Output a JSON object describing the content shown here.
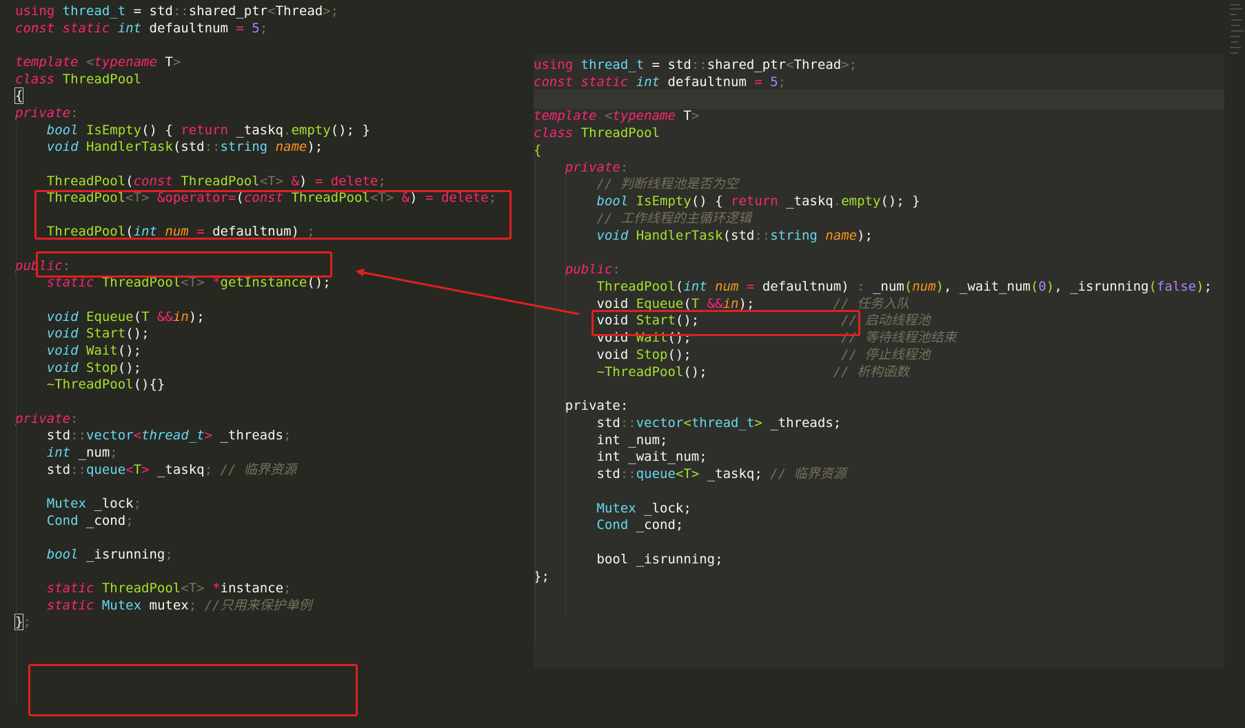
{
  "left_code": [
    [
      {
        "t": "using",
        "c": "kw"
      },
      {
        "t": " "
      },
      {
        "t": "thread_t",
        "c": "cls"
      },
      {
        "t": " = "
      },
      {
        "t": "std",
        "c": "txt"
      },
      {
        "t": "::",
        "c": "ph"
      },
      {
        "t": "shared_ptr",
        "c": "txt"
      },
      {
        "t": "<",
        "c": "ph"
      },
      {
        "t": "Thread",
        "c": "txt"
      },
      {
        "t": ">;",
        "c": "ph"
      }
    ],
    [
      {
        "t": "const",
        "c": "special"
      },
      {
        "t": " "
      },
      {
        "t": "static",
        "c": "special"
      },
      {
        "t": " "
      },
      {
        "t": "int",
        "c": "type"
      },
      {
        "t": " defaultnum "
      },
      {
        "t": "=",
        "c": "kw"
      },
      {
        "t": " "
      },
      {
        "t": "5",
        "c": "num"
      },
      {
        "t": ";",
        "c": "ph"
      }
    ],
    [],
    [
      {
        "t": "template",
        "c": "special"
      },
      {
        "t": " "
      },
      {
        "t": "<",
        "c": "ph"
      },
      {
        "t": "typename",
        "c": "special"
      },
      {
        "t": " T"
      },
      {
        "t": ">",
        "c": "ph"
      }
    ],
    [
      {
        "t": "class",
        "c": "special"
      },
      {
        "t": " "
      },
      {
        "t": "ThreadPool",
        "c": "fn"
      }
    ],
    [
      {
        "t": "{",
        "c": "brace"
      }
    ],
    [
      {
        "t": "private",
        "c": "special"
      },
      {
        "t": ":",
        "c": "ph"
      }
    ],
    [
      {
        "t": "    "
      },
      {
        "t": "bool",
        "c": "type"
      },
      {
        "t": " "
      },
      {
        "t": "IsEmpty",
        "c": "fn"
      },
      {
        "t": "() { "
      },
      {
        "t": "return",
        "c": "kw"
      },
      {
        "t": " _taskq"
      },
      {
        "t": ".",
        "c": "ph"
      },
      {
        "t": "empty",
        "c": "fn"
      },
      {
        "t": "(); }"
      }
    ],
    [
      {
        "t": "    "
      },
      {
        "t": "void",
        "c": "type"
      },
      {
        "t": " "
      },
      {
        "t": "HandlerTask",
        "c": "fn"
      },
      {
        "t": "(std"
      },
      {
        "t": "::",
        "c": "ph"
      },
      {
        "t": "string",
        "c": "cls"
      },
      {
        "t": " "
      },
      {
        "t": "name",
        "c": "param"
      },
      {
        "t": ");"
      }
    ],
    [],
    [
      {
        "t": "    "
      },
      {
        "t": "ThreadPool",
        "c": "fn"
      },
      {
        "t": "("
      },
      {
        "t": "const",
        "c": "special"
      },
      {
        "t": " "
      },
      {
        "t": "ThreadPool",
        "c": "fn"
      },
      {
        "t": "<",
        "c": "ph"
      },
      {
        "t": "T",
        "c": "ph"
      },
      {
        "t": ">",
        "c": "ph"
      },
      {
        "t": " "
      },
      {
        "t": "&",
        "c": "kw"
      },
      {
        "t": ") "
      },
      {
        "t": "=",
        "c": "kw"
      },
      {
        "t": " "
      },
      {
        "t": "delete",
        "c": "kw"
      },
      {
        "t": ";",
        "c": "ph"
      }
    ],
    [
      {
        "t": "    "
      },
      {
        "t": "ThreadPool",
        "c": "fn"
      },
      {
        "t": "<",
        "c": "ph"
      },
      {
        "t": "T",
        "c": "ph"
      },
      {
        "t": ">",
        "c": "ph"
      },
      {
        "t": " "
      },
      {
        "t": "&",
        "c": "kw"
      },
      {
        "t": "operator=",
        "c": "kw"
      },
      {
        "t": "("
      },
      {
        "t": "const",
        "c": "special"
      },
      {
        "t": " "
      },
      {
        "t": "ThreadPool",
        "c": "fn"
      },
      {
        "t": "<",
        "c": "ph"
      },
      {
        "t": "T",
        "c": "ph"
      },
      {
        "t": ">",
        "c": "ph"
      },
      {
        "t": " "
      },
      {
        "t": "&",
        "c": "kw"
      },
      {
        "t": ") "
      },
      {
        "t": "=",
        "c": "kw"
      },
      {
        "t": " "
      },
      {
        "t": "delete",
        "c": "kw"
      },
      {
        "t": ";",
        "c": "ph"
      }
    ],
    [],
    [
      {
        "t": "    "
      },
      {
        "t": "ThreadPool",
        "c": "fn"
      },
      {
        "t": "("
      },
      {
        "t": "int",
        "c": "type"
      },
      {
        "t": " "
      },
      {
        "t": "num",
        "c": "param"
      },
      {
        "t": " "
      },
      {
        "t": "=",
        "c": "kw"
      },
      {
        "t": " defaultnum) "
      },
      {
        "t": ";",
        "c": "ph"
      }
    ],
    [],
    [
      {
        "t": "public",
        "c": "special"
      },
      {
        "t": ":",
        "c": "ph"
      }
    ],
    [
      {
        "t": "    "
      },
      {
        "t": "static",
        "c": "special"
      },
      {
        "t": " "
      },
      {
        "t": "ThreadPool",
        "c": "fn"
      },
      {
        "t": "<",
        "c": "ph"
      },
      {
        "t": "T",
        "c": "ph"
      },
      {
        "t": ">",
        "c": "ph"
      },
      {
        "t": " "
      },
      {
        "t": "*",
        "c": "kw"
      },
      {
        "t": "getInstance",
        "c": "fn"
      },
      {
        "t": "();"
      }
    ],
    [],
    [
      {
        "t": "    "
      },
      {
        "t": "void",
        "c": "type"
      },
      {
        "t": " "
      },
      {
        "t": "Equeue",
        "c": "fn"
      },
      {
        "t": "("
      },
      {
        "t": "T",
        "c": "fn"
      },
      {
        "t": " "
      },
      {
        "t": "&&",
        "c": "kw"
      },
      {
        "t": "in",
        "c": "param"
      },
      {
        "t": ");"
      }
    ],
    [
      {
        "t": "    "
      },
      {
        "t": "void",
        "c": "type"
      },
      {
        "t": " "
      },
      {
        "t": "Start",
        "c": "fn"
      },
      {
        "t": "();"
      }
    ],
    [
      {
        "t": "    "
      },
      {
        "t": "void",
        "c": "type"
      },
      {
        "t": " "
      },
      {
        "t": "Wait",
        "c": "fn"
      },
      {
        "t": "();"
      }
    ],
    [
      {
        "t": "    "
      },
      {
        "t": "void",
        "c": "type"
      },
      {
        "t": " "
      },
      {
        "t": "Stop",
        "c": "fn"
      },
      {
        "t": "();"
      }
    ],
    [
      {
        "t": "    "
      },
      {
        "t": "~ThreadPool",
        "c": "fn"
      },
      {
        "t": "(){}"
      }
    ],
    [],
    [
      {
        "t": "private",
        "c": "special"
      },
      {
        "t": ":",
        "c": "ph"
      }
    ],
    [
      {
        "t": "    std"
      },
      {
        "t": "::",
        "c": "ph"
      },
      {
        "t": "vector",
        "c": "cls"
      },
      {
        "t": "<",
        "c": "kw"
      },
      {
        "t": "thread_t",
        "c": "type"
      },
      {
        "t": ">",
        "c": "kw"
      },
      {
        "t": " _threads"
      },
      {
        "t": ";",
        "c": "ph"
      }
    ],
    [
      {
        "t": "    "
      },
      {
        "t": "int",
        "c": "type"
      },
      {
        "t": " _num"
      },
      {
        "t": ";",
        "c": "ph"
      }
    ],
    [
      {
        "t": "    std"
      },
      {
        "t": "::",
        "c": "ph"
      },
      {
        "t": "queue",
        "c": "cls"
      },
      {
        "t": "<",
        "c": "kw"
      },
      {
        "t": "T",
        "c": "fn"
      },
      {
        "t": ">",
        "c": "kw"
      },
      {
        "t": " _taskq"
      },
      {
        "t": ";",
        "c": "ph"
      },
      {
        "t": " "
      },
      {
        "t": "// 临界资源",
        "c": "comment"
      }
    ],
    [],
    [
      {
        "t": "    "
      },
      {
        "t": "Mutex",
        "c": "cls"
      },
      {
        "t": " _lock"
      },
      {
        "t": ";",
        "c": "ph"
      }
    ],
    [
      {
        "t": "    "
      },
      {
        "t": "Cond",
        "c": "cls"
      },
      {
        "t": " _cond"
      },
      {
        "t": ";",
        "c": "ph"
      }
    ],
    [],
    [
      {
        "t": "    "
      },
      {
        "t": "bool",
        "c": "type"
      },
      {
        "t": " _isrunning"
      },
      {
        "t": ";",
        "c": "ph"
      }
    ],
    [],
    [
      {
        "t": "    "
      },
      {
        "t": "static",
        "c": "special"
      },
      {
        "t": " "
      },
      {
        "t": "ThreadPool",
        "c": "fn"
      },
      {
        "t": "<",
        "c": "ph"
      },
      {
        "t": "T",
        "c": "ph"
      },
      {
        "t": ">",
        "c": "ph"
      },
      {
        "t": " "
      },
      {
        "t": "*",
        "c": "kw"
      },
      {
        "t": "instance"
      },
      {
        "t": ";",
        "c": "ph"
      }
    ],
    [
      {
        "t": "    "
      },
      {
        "t": "static",
        "c": "special"
      },
      {
        "t": " "
      },
      {
        "t": "Mutex",
        "c": "cls"
      },
      {
        "t": " mutex"
      },
      {
        "t": ";",
        "c": "ph"
      },
      {
        "t": " "
      },
      {
        "t": "//只用来保护单例",
        "c": "comment"
      }
    ],
    [
      {
        "t": "}",
        "c": "brace"
      },
      {
        "t": ";",
        "c": "ph"
      }
    ]
  ],
  "right_code": [
    [
      {
        "t": "using",
        "c": "kw"
      },
      {
        "t": " "
      },
      {
        "t": "thread_t",
        "c": "cls"
      },
      {
        "t": " = "
      },
      {
        "t": "std",
        "c": "txt"
      },
      {
        "t": "::",
        "c": "ph"
      },
      {
        "t": "shared_ptr",
        "c": "txt"
      },
      {
        "t": "<",
        "c": "ph"
      },
      {
        "t": "Thread",
        "c": "txt"
      },
      {
        "t": ">;",
        "c": "ph"
      }
    ],
    [
      {
        "t": "const",
        "c": "special"
      },
      {
        "t": " "
      },
      {
        "t": "static",
        "c": "special"
      },
      {
        "t": " "
      },
      {
        "t": "int",
        "c": "type"
      },
      {
        "t": " defaultnum "
      },
      {
        "t": "=",
        "c": "kw"
      },
      {
        "t": " "
      },
      {
        "t": "5",
        "c": "num"
      },
      {
        "t": ";",
        "c": "ph"
      }
    ],
    [],
    [
      {
        "t": "template",
        "c": "special"
      },
      {
        "t": " "
      },
      {
        "t": "<",
        "c": "ph"
      },
      {
        "t": "typename",
        "c": "special"
      },
      {
        "t": " T"
      },
      {
        "t": ">",
        "c": "ph"
      }
    ],
    [
      {
        "t": "class",
        "c": "special"
      },
      {
        "t": " "
      },
      {
        "t": "ThreadPool",
        "c": "fn"
      }
    ],
    [
      {
        "t": "{",
        "c": "fn"
      }
    ],
    [
      {
        "t": "    "
      },
      {
        "t": "private",
        "c": "special"
      },
      {
        "t": ":",
        "c": "ph"
      }
    ],
    [
      {
        "t": "        "
      },
      {
        "t": "// 判断线程池是否为空",
        "c": "comment"
      }
    ],
    [
      {
        "t": "        "
      },
      {
        "t": "bool",
        "c": "type"
      },
      {
        "t": " "
      },
      {
        "t": "IsEmpty",
        "c": "fn"
      },
      {
        "t": "() { "
      },
      {
        "t": "return",
        "c": "kw"
      },
      {
        "t": " _taskq"
      },
      {
        "t": ".",
        "c": "ph"
      },
      {
        "t": "empty",
        "c": "fn"
      },
      {
        "t": "(); }"
      }
    ],
    [
      {
        "t": "        "
      },
      {
        "t": "// 工作线程的主循环逻辑",
        "c": "comment"
      }
    ],
    [
      {
        "t": "        "
      },
      {
        "t": "void",
        "c": "type"
      },
      {
        "t": " "
      },
      {
        "t": "HandlerTask",
        "c": "fn"
      },
      {
        "t": "(std"
      },
      {
        "t": "::",
        "c": "ph"
      },
      {
        "t": "string",
        "c": "cls"
      },
      {
        "t": " "
      },
      {
        "t": "name",
        "c": "param"
      },
      {
        "t": ");"
      }
    ],
    [],
    [
      {
        "t": "    "
      },
      {
        "t": "public",
        "c": "special"
      },
      {
        "t": ":",
        "c": "ph"
      }
    ],
    [
      {
        "t": "        "
      },
      {
        "t": "ThreadPool",
        "c": "fn"
      },
      {
        "t": "("
      },
      {
        "t": "int",
        "c": "type"
      },
      {
        "t": " "
      },
      {
        "t": "num",
        "c": "param"
      },
      {
        "t": " "
      },
      {
        "t": "=",
        "c": "kw"
      },
      {
        "t": " defaultnum)"
      },
      {
        "t": " : ",
        "c": "ph"
      },
      {
        "t": "_num"
      },
      {
        "t": "(",
        "c": "fn"
      },
      {
        "t": "num",
        "c": "param"
      },
      {
        "t": ")",
        "c": "fn"
      },
      {
        "t": ", "
      },
      {
        "t": "_wait_num"
      },
      {
        "t": "(",
        "c": "fn"
      },
      {
        "t": "0",
        "c": "num"
      },
      {
        "t": ")",
        "c": "fn"
      },
      {
        "t": ", "
      },
      {
        "t": "_isrunning"
      },
      {
        "t": "(",
        "c": "fn"
      },
      {
        "t": "false",
        "c": "num"
      },
      {
        "t": ")",
        "c": "fn"
      },
      {
        "t": ";"
      }
    ],
    [
      {
        "t": "        void "
      },
      {
        "t": "Equeue",
        "c": "fn"
      },
      {
        "t": "("
      },
      {
        "t": "T",
        "c": "fn"
      },
      {
        "t": " "
      },
      {
        "t": "&&",
        "c": "kw"
      },
      {
        "t": "in",
        "c": "param"
      },
      {
        "t": ");"
      },
      {
        "t": "          "
      },
      {
        "t": "// 任务入队",
        "c": "comment"
      }
    ],
    [
      {
        "t": "        void "
      },
      {
        "t": "Start",
        "c": "fn"
      },
      {
        "t": "();"
      },
      {
        "t": "                  "
      },
      {
        "t": "// 启动线程池",
        "c": "comment"
      }
    ],
    [
      {
        "t": "        void "
      },
      {
        "t": "Wait",
        "c": "fn"
      },
      {
        "t": "();"
      },
      {
        "t": "                   "
      },
      {
        "t": "// 等待线程池结束",
        "c": "comment"
      }
    ],
    [
      {
        "t": "        void "
      },
      {
        "t": "Stop",
        "c": "fn"
      },
      {
        "t": "();"
      },
      {
        "t": "                   "
      },
      {
        "t": "// 停止线程池",
        "c": "comment"
      }
    ],
    [
      {
        "t": "        "
      },
      {
        "t": "~ThreadPool",
        "c": "fn"
      },
      {
        "t": "();"
      },
      {
        "t": "                "
      },
      {
        "t": "// 析构函数",
        "c": "comment"
      }
    ],
    [],
    [
      {
        "t": "    private:"
      }
    ],
    [
      {
        "t": "        std"
      },
      {
        "t": "::",
        "c": "ph"
      },
      {
        "t": "vector",
        "c": "cls"
      },
      {
        "t": "<",
        "c": "fn"
      },
      {
        "t": "thread_t",
        "c": "cls"
      },
      {
        "t": ">",
        "c": "fn"
      },
      {
        "t": " _threads;"
      }
    ],
    [
      {
        "t": "        int _num;"
      }
    ],
    [
      {
        "t": "        int _wait_num;"
      }
    ],
    [
      {
        "t": "        std"
      },
      {
        "t": "::",
        "c": "ph"
      },
      {
        "t": "queue",
        "c": "cls"
      },
      {
        "t": "<",
        "c": "fn"
      },
      {
        "t": "T",
        "c": "fn"
      },
      {
        "t": ">",
        "c": "fn"
      },
      {
        "t": " _taskq;"
      },
      {
        "t": " "
      },
      {
        "t": "// 临界资源",
        "c": "comment"
      }
    ],
    [],
    [
      {
        "t": "        "
      },
      {
        "t": "Mutex",
        "c": "cls"
      },
      {
        "t": " _lock;"
      }
    ],
    [
      {
        "t": "        "
      },
      {
        "t": "Cond",
        "c": "cls"
      },
      {
        "t": " _cond;"
      }
    ],
    [],
    [
      {
        "t": "        bool _isrunning;"
      }
    ],
    [
      {
        "t": "};"
      }
    ]
  ],
  "colors": {
    "background": "#272822",
    "panel_background": "#2e2f2a",
    "annotation_red": "#e02020",
    "keyword": "#f92672",
    "type": "#66d9ef",
    "function": "#a6e22e",
    "number": "#ae81ff",
    "comment": "#75715e",
    "parameter": "#fd971f",
    "text": "#f8f8f2"
  }
}
